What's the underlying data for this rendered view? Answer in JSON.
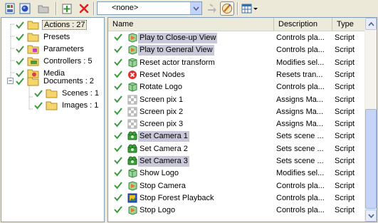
{
  "toolbar": {
    "buttons": [
      "new-document-icon",
      "globe-icon",
      "folder-icon",
      "add-icon",
      "delete-icon"
    ],
    "combo_value": "<none>",
    "extra_icons": [
      "dim-arrow-icon",
      "pencil-icon",
      "grid-dropdown-icon"
    ]
  },
  "tree": {
    "items": [
      {
        "label": "Actions : 27",
        "icon": "folder-icon",
        "selected": true
      },
      {
        "label": "Presets",
        "icon": "folder-icon"
      },
      {
        "label": "Parameters",
        "icon": "folder-icon"
      },
      {
        "label": "Controllers : 5",
        "icon": "folder-icon"
      },
      {
        "label": "Media",
        "icon": "folder-icon"
      },
      {
        "label": "Documents : 2",
        "icon": "folder-icon"
      },
      {
        "label": "Scenes : 1",
        "icon": "folder-icon"
      },
      {
        "label": "Images : 1",
        "icon": "folder-icon"
      }
    ]
  },
  "list": {
    "columns": {
      "name": "Name",
      "description": "Description",
      "type": "Type"
    },
    "rows": [
      {
        "name": "Play to Close-up View",
        "desc": "Controls pla...",
        "type": "Script",
        "highlight": true,
        "icon": "play-icon"
      },
      {
        "name": "Play to General View",
        "desc": "Controls pla...",
        "type": "Script",
        "highlight": true,
        "icon": "play-icon"
      },
      {
        "name": "Reset actor transform",
        "desc": "Modifies sel...",
        "type": "Script",
        "highlight": false,
        "icon": "cube-icon"
      },
      {
        "name": "Reset Nodes",
        "desc": "Resets tran...",
        "type": "Script",
        "highlight": false,
        "icon": "reset-icon"
      },
      {
        "name": "Rotate Logo",
        "desc": "Controls pla...",
        "type": "Script",
        "highlight": false,
        "icon": "cube-icon"
      },
      {
        "name": "Screen pix 1",
        "desc": "Assigns Ma...",
        "type": "Script",
        "highlight": false,
        "icon": "checker-icon"
      },
      {
        "name": "Screen pix 2",
        "desc": "Assigns Ma...",
        "type": "Script",
        "highlight": false,
        "icon": "checker-icon"
      },
      {
        "name": "Screen pix 3",
        "desc": "Assigns Ma...",
        "type": "Script",
        "highlight": false,
        "icon": "checker-icon"
      },
      {
        "name": "Set Camera 1",
        "desc": "Sets scene ...",
        "type": "Script",
        "highlight": true,
        "icon": "camera-icon"
      },
      {
        "name": "Set Camera 2",
        "desc": "Sets scene ...",
        "type": "Script",
        "highlight": false,
        "icon": "camera-icon"
      },
      {
        "name": "Set Camera 3",
        "desc": "Sets scene ...",
        "type": "Script",
        "highlight": true,
        "icon": "camera-icon"
      },
      {
        "name": "Show Logo",
        "desc": "Modifies sel...",
        "type": "Script",
        "highlight": false,
        "icon": "cube-icon"
      },
      {
        "name": "Stop Camera",
        "desc": "Controls pla...",
        "type": "Script",
        "highlight": false,
        "icon": "play-icon"
      },
      {
        "name": "Stop Forest Playback",
        "desc": "Controls pla...",
        "type": "Script",
        "highlight": false,
        "icon": "film-icon"
      },
      {
        "name": "Stop Logo",
        "desc": "Controls pla...",
        "type": "Script",
        "highlight": false,
        "icon": "play-icon"
      }
    ]
  },
  "colors": {
    "check": "#3c9a3c",
    "folder": "#f5d66b",
    "highlight": "#c8c8d8",
    "border": "#7f9db9"
  }
}
